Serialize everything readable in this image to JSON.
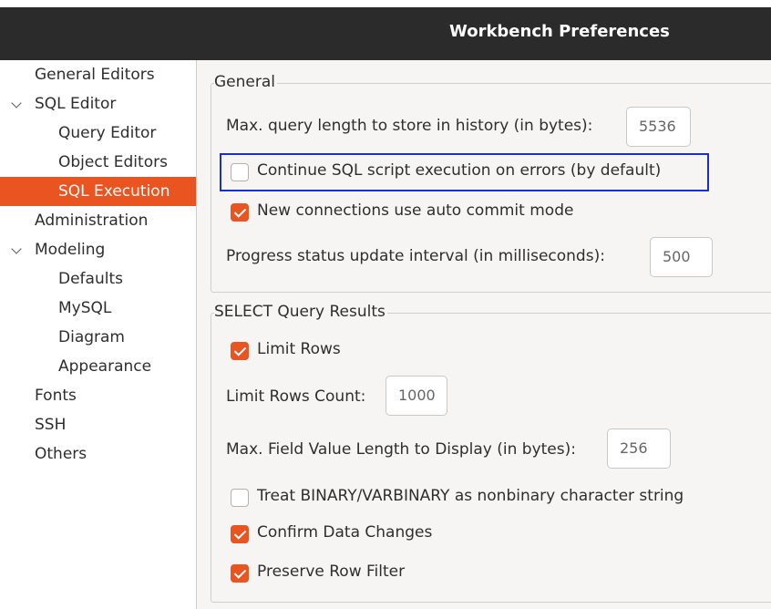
{
  "window": {
    "title": "Workbench Preferences"
  },
  "sidebar": {
    "items": [
      {
        "label": "General Editors"
      },
      {
        "label": "SQL Editor",
        "expanded": true
      },
      {
        "label": "Query Editor"
      },
      {
        "label": "Object Editors"
      },
      {
        "label": "SQL Execution",
        "selected": true
      },
      {
        "label": "Administration"
      },
      {
        "label": "Modeling",
        "expanded": true
      },
      {
        "label": "Defaults"
      },
      {
        "label": "MySQL"
      },
      {
        "label": "Diagram"
      },
      {
        "label": "Appearance"
      },
      {
        "label": "Fonts"
      },
      {
        "label": "SSH"
      },
      {
        "label": "Others"
      }
    ]
  },
  "general": {
    "title": "General",
    "max_query_length": {
      "label": "Max. query length to store in history (in bytes):",
      "value": "5536"
    },
    "continue_on_errors": {
      "label": "Continue SQL script execution on errors (by default)",
      "checked": false
    },
    "auto_commit": {
      "label": "New connections use auto commit mode",
      "checked": true
    },
    "progress_interval": {
      "label": "Progress status update interval (in milliseconds):",
      "value": "500"
    }
  },
  "select_results": {
    "title": "SELECT Query Results",
    "limit_rows": {
      "label": "Limit Rows",
      "checked": true
    },
    "limit_rows_count": {
      "label": "Limit Rows Count:",
      "value": "1000"
    },
    "max_field_length": {
      "label": "Max. Field Value Length to Display (in bytes):",
      "value": "256"
    },
    "treat_binary": {
      "label": "Treat BINARY/VARBINARY as nonbinary character string",
      "checked": false
    },
    "confirm_changes": {
      "label": "Confirm Data Changes",
      "checked": true
    },
    "preserve_filter": {
      "label": "Preserve Row Filter",
      "checked": true
    }
  },
  "colors": {
    "accent": "#e95420",
    "titlebar": "#2b2b2b",
    "focus": "#1a31c9"
  }
}
